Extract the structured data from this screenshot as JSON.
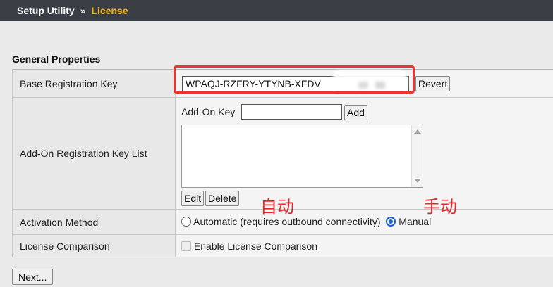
{
  "breadcrumb": {
    "root": "Setup Utility",
    "separator": "»",
    "current": "License"
  },
  "section_title": "General Properties",
  "base_key": {
    "label": "Base Registration Key",
    "value": "WPAQJ-RZFRY-YTYNB-XFDV",
    "revert_label": "Revert"
  },
  "addon": {
    "label": "Add-On Registration Key List",
    "key_label": "Add-On Key",
    "key_value": "",
    "add_label": "Add",
    "edit_label": "Edit",
    "delete_label": "Delete"
  },
  "activation": {
    "label": "Activation Method",
    "automatic_label": "Automatic (requires outbound connectivity)",
    "manual_label": "Manual",
    "selected": "Manual"
  },
  "comparison": {
    "label": "License Comparison",
    "checkbox_label": "Enable License Comparison"
  },
  "annotations": {
    "auto": "自动",
    "manual": "手动",
    "color": "#e8242b"
  },
  "next_label": "Next...",
  "colors": {
    "topbar": "#3a3f45",
    "breadcrumb_current": "#f7b500",
    "highlight": "#e33333",
    "radio_selected": "#1a5fd0"
  }
}
